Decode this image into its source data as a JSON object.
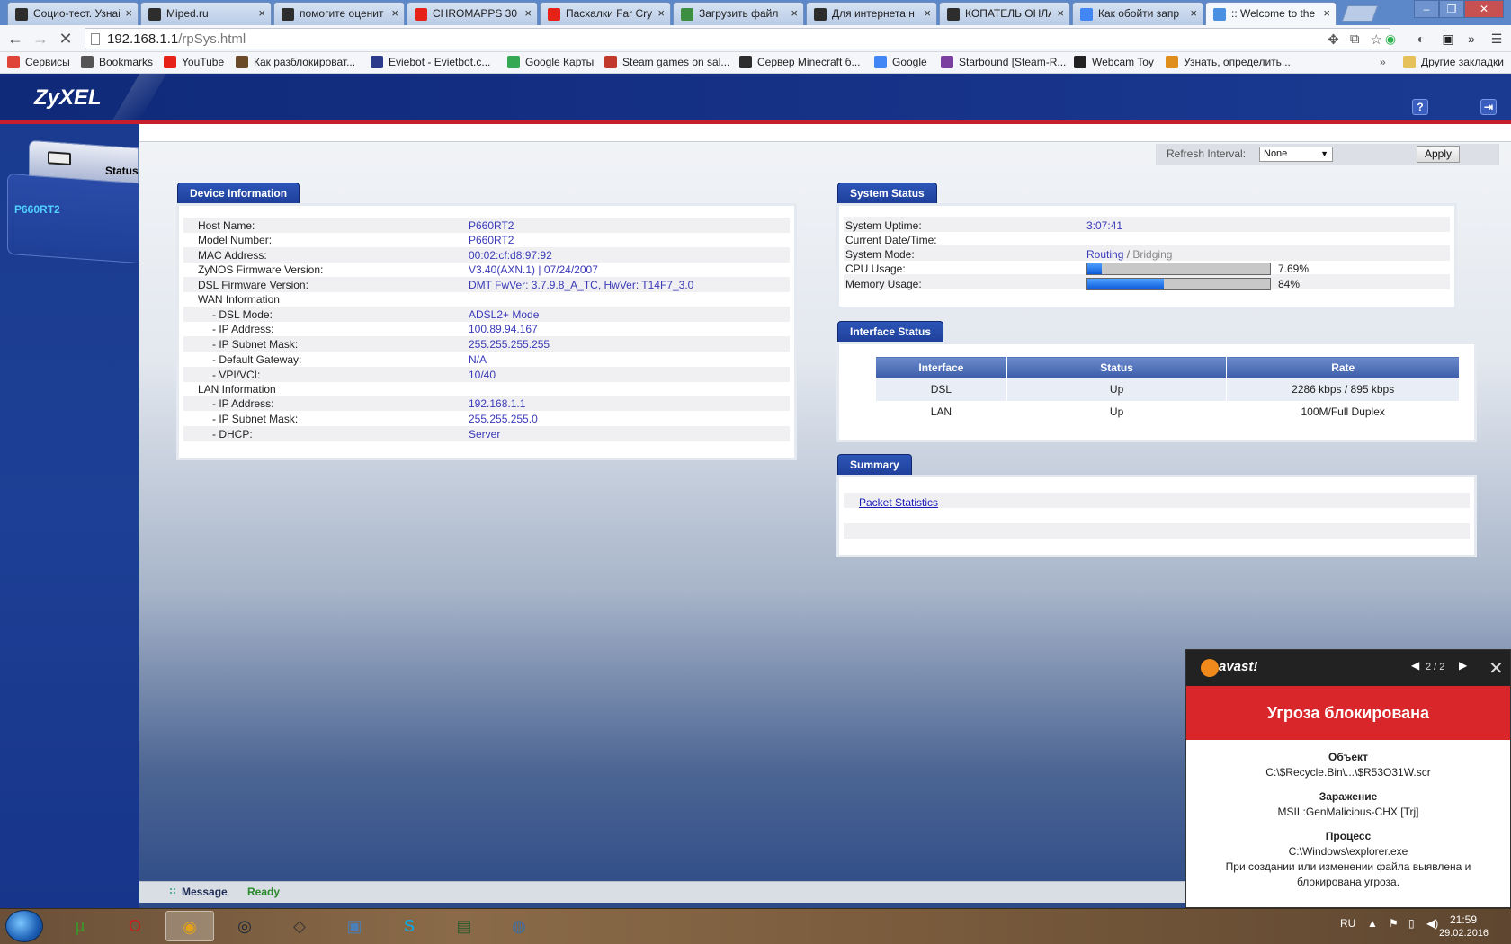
{
  "browser": {
    "tabs": [
      {
        "title": "Социо-тест. Узнай",
        "icon": "penguin-icon",
        "color": "#2d2d2d"
      },
      {
        "title": "Miped.ru",
        "icon": "penguin-icon",
        "color": "#2d2d2d"
      },
      {
        "title": "помогите оценит",
        "icon": "penguin-icon",
        "color": "#2d2d2d"
      },
      {
        "title": "CHROMAPPS 30",
        "icon": "youtube-icon",
        "color": "#e62117"
      },
      {
        "title": "Пасхалки Far Cry",
        "icon": "youtube-icon",
        "color": "#e62117"
      },
      {
        "title": "Загрузить файл",
        "icon": "upload-icon",
        "color": "#3e8e41"
      },
      {
        "title": "Для интернета н",
        "icon": "penguin-icon",
        "color": "#2d2d2d"
      },
      {
        "title": "КОПАТЕЛЬ ОНЛА",
        "icon": "penguin-icon",
        "color": "#2d2d2d"
      },
      {
        "title": "Как обойти запр",
        "icon": "google-icon",
        "color": "#4285f4"
      },
      {
        "title": ":: Welcome to the",
        "icon": "loading-icon",
        "color": "#4a90e2"
      }
    ],
    "address": {
      "host": "192.168.1.1",
      "path": "/rpSys.html"
    },
    "bookmarks": [
      {
        "label": "Сервисы",
        "icon": "apps-icon",
        "color": "#e0453a"
      },
      {
        "label": "Bookmarks",
        "icon": "star-icon",
        "color": "#555555"
      },
      {
        "label": "YouTube",
        "icon": "youtube-icon",
        "color": "#e62117"
      },
      {
        "label": "Как разблокироват...",
        "icon": "minecraft-icon",
        "color": "#6b4a2a"
      },
      {
        "label": "Eviebot - Evietbot.c...",
        "icon": "eviebot-icon",
        "color": "#2b3a8a"
      },
      {
        "label": "Google Карты",
        "icon": "maps-icon",
        "color": "#34a853"
      },
      {
        "label": "Steam games on sal...",
        "icon": "steam-icon",
        "color": "#c0392b"
      },
      {
        "label": "Сервер Minecraft б...",
        "icon": "penguin-icon",
        "color": "#2d2d2d"
      },
      {
        "label": "Google",
        "icon": "google-icon",
        "color": "#4285f4"
      },
      {
        "label": "Starbound [Steam-R...",
        "icon": "starbound-icon",
        "color": "#7b3fa0"
      },
      {
        "label": "Webcam Toy",
        "icon": "webcam-icon",
        "color": "#222222"
      },
      {
        "label": "Узнать, определить...",
        "icon": "gift-icon",
        "color": "#e08e1b"
      }
    ],
    "bookmarks_overflow": "»",
    "other_bookmarks": "Другие закладки"
  },
  "zyxel": {
    "logo": "ZyXEL",
    "nav": {
      "status_label": "Status",
      "device_name": "P660RT2"
    },
    "refresh": {
      "label": "Refresh Interval:",
      "value": "None",
      "apply": "Apply"
    },
    "device_info": {
      "title": "Device Information",
      "rows": [
        {
          "label": "Host Name:",
          "value": "P660RT2"
        },
        {
          "label": "Model Number:",
          "value": "P660RT2"
        },
        {
          "label": "MAC Address:",
          "value": "00:02:cf:d8:97:92"
        },
        {
          "label": "ZyNOS Firmware Version:",
          "value": "V3.40(AXN.1) | 07/24/2007"
        },
        {
          "label": "DSL Firmware Version:",
          "value": "DMT FwVer: 3.7.9.8_A_TC, HwVer: T14F7_3.0"
        },
        {
          "label": "WAN Information",
          "value": ""
        },
        {
          "label": "- DSL Mode:",
          "value": "ADSL2+ Mode"
        },
        {
          "label": "- IP Address:",
          "value": "100.89.94.167"
        },
        {
          "label": "- IP Subnet Mask:",
          "value": "255.255.255.255"
        },
        {
          "label": "- Default Gateway:",
          "value": "N/A"
        },
        {
          "label": "- VPI/VCI:",
          "value": "10/40"
        },
        {
          "label": "LAN Information",
          "value": ""
        },
        {
          "label": "- IP Address:",
          "value": "192.168.1.1"
        },
        {
          "label": "- IP Subnet Mask:",
          "value": "255.255.255.0"
        },
        {
          "label": "- DHCP:",
          "value": "Server"
        }
      ]
    },
    "system_status": {
      "title": "System Status",
      "uptime_label": "System Uptime:",
      "uptime": "3:07:41",
      "datetime_label": "Current Date/Time:",
      "datetime": "",
      "mode_label": "System Mode:",
      "mode_active": "Routing",
      "mode_sep": " / ",
      "mode_inactive": "Bridging",
      "cpu_label": "CPU Usage:",
      "cpu_text": "7.69%",
      "cpu_fraction": 0.0769,
      "mem_label": "Memory Usage:",
      "mem_text": "84%",
      "mem_fraction": 0.42
    },
    "interface_status": {
      "title": "Interface Status",
      "columns": [
        "Interface",
        "Status",
        "Rate"
      ],
      "rows": [
        [
          "DSL",
          "Up",
          "2286 kbps / 895 kbps"
        ],
        [
          "LAN",
          "Up",
          "100M/Full Duplex"
        ]
      ]
    },
    "summary": {
      "title": "Summary",
      "link": "Packet Statistics"
    },
    "message": {
      "label": "Message",
      "text": "Ready"
    }
  },
  "avast": {
    "logo": "avast!",
    "pager": "2 / 2",
    "banner": "Угроза блокирована",
    "object_label": "Объект",
    "object_value": "C:\\$Recycle.Bin\\...\\$R53O31W.scr",
    "infection_label": "Заражение",
    "infection_value": "MSIL:GenMalicious-CHX [Trj]",
    "process_label": "Процесс",
    "process_value": "C:\\Windows\\explorer.exe",
    "note_line1": "При создании или изменении файла выявлена и",
    "note_line2": "блокирована угроза."
  },
  "taskbar": {
    "apps": [
      {
        "name": "utorrent-icon",
        "glyph": "µ",
        "color": "#3a9a2a"
      },
      {
        "name": "opera-icon",
        "glyph": "O",
        "color": "#cc1b1b"
      },
      {
        "name": "chrome-icon",
        "glyph": "◉",
        "color": "#e3a21a"
      },
      {
        "name": "steam-icon",
        "glyph": "◎",
        "color": "#1b2838"
      },
      {
        "name": "unity-icon",
        "glyph": "◇",
        "color": "#333333"
      },
      {
        "name": "photos-icon",
        "glyph": "▣",
        "color": "#4a7fb8"
      },
      {
        "name": "skype-icon",
        "glyph": "S",
        "color": "#00aff0"
      },
      {
        "name": "terminal-icon",
        "glyph": "▤",
        "color": "#2e5a2e"
      },
      {
        "name": "network-icon",
        "glyph": "◍",
        "color": "#3a6ea5"
      }
    ],
    "lang": "RU",
    "time": "21:59",
    "date": "29.02.2016"
  }
}
